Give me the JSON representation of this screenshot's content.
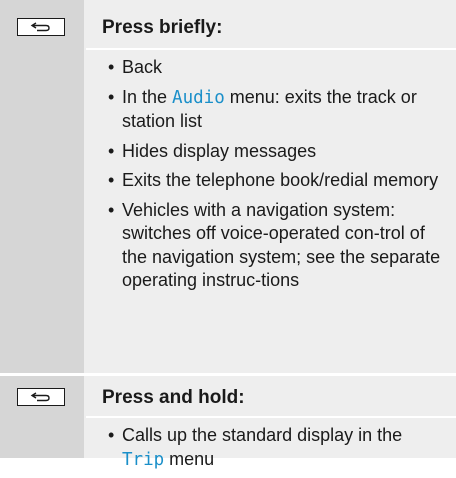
{
  "rows": [
    {
      "key_icon": "back-key-icon",
      "heading": "Press briefly:",
      "items": [
        {
          "text": "Back"
        },
        {
          "pre": "In the ",
          "code": "Audio",
          "post": " menu: exits the track or station list"
        },
        {
          "text": "Hides display messages"
        },
        {
          "text": "Exits the telephone book/redial memory"
        },
        {
          "text": "Vehicles with a navigation system: switches off voice-operated con-trol of the navigation system; see the separate operating instruc-tions"
        }
      ]
    },
    {
      "key_icon": "back-key-icon",
      "heading": "Press and hold:",
      "items": [
        {
          "pre": "Calls up the standard display in the ",
          "code": "Trip",
          "post": " menu"
        }
      ]
    }
  ],
  "colors": {
    "key_column_bg": "#d6d6d6",
    "content_bg": "#eeeeee",
    "menu_name_text": "#1a8fc9"
  }
}
